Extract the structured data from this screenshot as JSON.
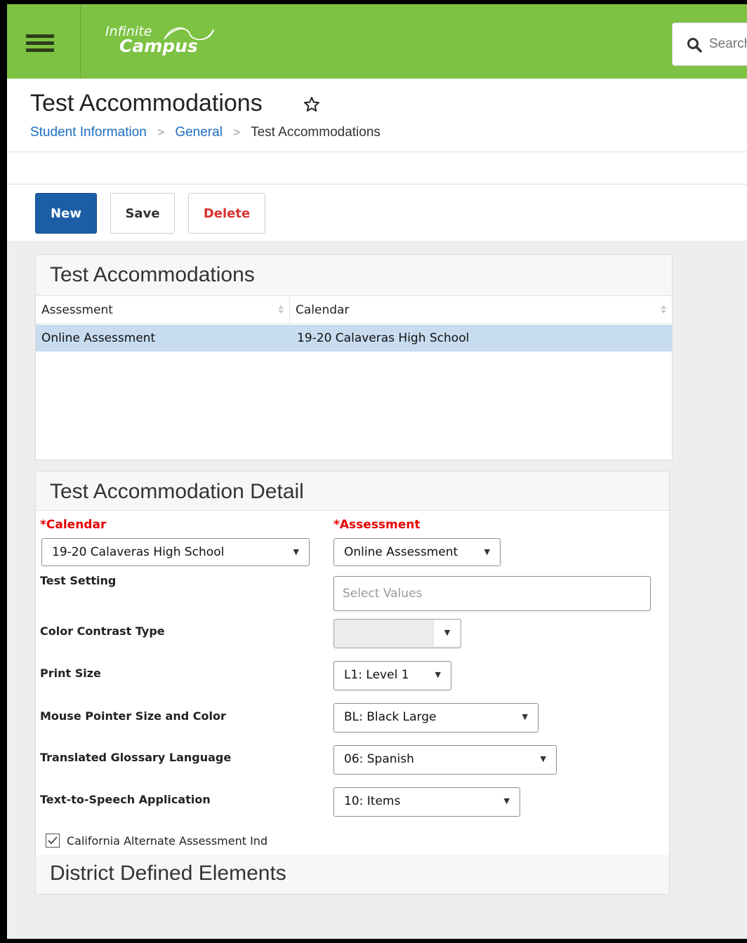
{
  "header": {
    "logo_line1": "Infinite",
    "logo_line2": "Campus",
    "search_placeholder": "Search"
  },
  "page": {
    "title": "Test Accommodations",
    "breadcrumb": [
      "Student Information",
      "General",
      "Test Accommodations"
    ]
  },
  "toolbar": {
    "new_label": "New",
    "save_label": "Save",
    "delete_label": "Delete"
  },
  "list_panel": {
    "title": "Test Accommodations",
    "columns": [
      "Assessment",
      "Calendar"
    ],
    "rows": [
      {
        "assessment": "Online Assessment",
        "calendar": "19-20 Calaveras High School"
      }
    ]
  },
  "detail_panel": {
    "title": "Test Accommodation Detail",
    "calendar_label": "*Calendar",
    "calendar_value": "19-20 Calaveras High School",
    "assessment_label": "*Assessment",
    "assessment_value": "Online Assessment",
    "test_setting_label": "Test Setting",
    "test_setting_placeholder": "Select Values",
    "color_contrast_label": "Color Contrast Type",
    "color_contrast_value": "",
    "print_size_label": "Print Size",
    "print_size_value": "L1: Level 1",
    "mouse_pointer_label": "Mouse Pointer Size and Color",
    "mouse_pointer_value": "BL: Black Large",
    "glossary_label": "Translated Glossary Language",
    "glossary_value": "06: Spanish",
    "tts_label": "Text-to-Speech Application",
    "tts_value": "10: Items",
    "caa_label": "California Alternate Assessment Ind",
    "caa_checked": true,
    "dde_title": "District Defined Elements"
  },
  "icons": {
    "menu": "hamburger-icon",
    "search": "search-icon",
    "favorite": "star-outline-icon",
    "dropdown": "caret-down-icon"
  },
  "colors": {
    "header_green": "#7dc242",
    "primary_blue": "#1b5ea6",
    "link_blue": "#1b6ec2",
    "delete_red": "#d63230",
    "required_red": "#e60000",
    "selected_row": "#c7dcef"
  }
}
